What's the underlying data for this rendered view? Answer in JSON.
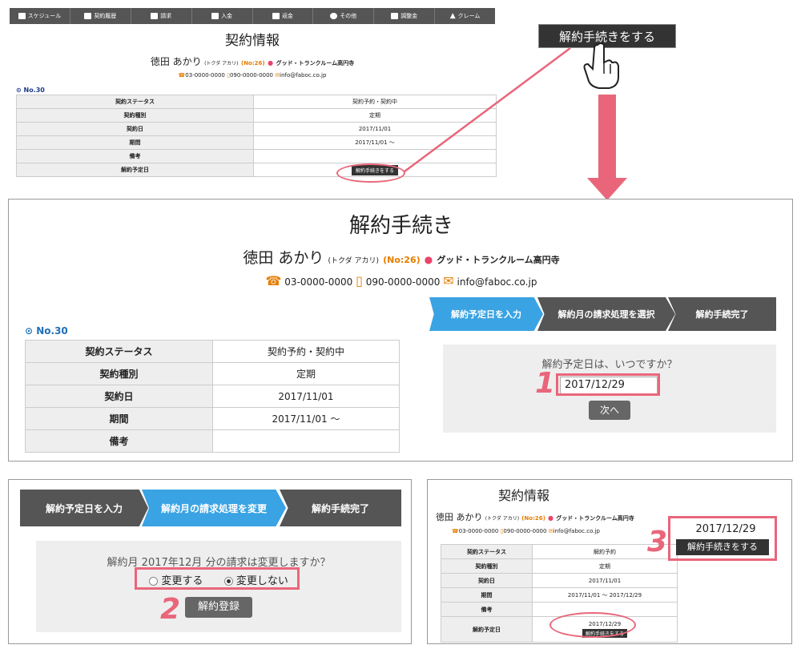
{
  "nav": [
    "スケジュール",
    "契約履歴",
    "請求",
    "入金",
    "返金",
    "その他",
    "調整金",
    "クレーム"
  ],
  "customer": {
    "name": "徳田 あかり",
    "kana": "(トクダ アカリ)",
    "no": "(No:26)",
    "store": "グッド・トランクルーム高円寺",
    "phone": "03-0000-0000",
    "mobile": "090-0000-0000",
    "email": "info@faboc.co.jp"
  },
  "screen1": {
    "title": "契約情報",
    "contract_no": "No.30",
    "rows": [
      {
        "k": "契約ステータス",
        "v": "契約予約・契約中"
      },
      {
        "k": "契約種別",
        "v": "定期"
      },
      {
        "k": "契約日",
        "v": "2017/11/01"
      },
      {
        "k": "期間",
        "v": "2017/11/01 ～"
      },
      {
        "k": "備考",
        "v": ""
      },
      {
        "k": "解約予定日",
        "v": ""
      }
    ],
    "cancel_button": "解約手続きをする"
  },
  "callout_button": "解約手続きをする",
  "screen2": {
    "title": "解約手続き",
    "contract_no": "No.30",
    "rows": [
      {
        "k": "契約ステータス",
        "v": "契約予約・契約中"
      },
      {
        "k": "契約種別",
        "v": "定期"
      },
      {
        "k": "契約日",
        "v": "2017/11/01"
      },
      {
        "k": "期間",
        "v": "2017/11/01 ～"
      },
      {
        "k": "備考",
        "v": ""
      }
    ],
    "steps": [
      "解約予定日を入力",
      "解約月の請求処理を選択",
      "解約手続完了"
    ],
    "question": "解約予定日は、いつですか？",
    "date_value": "2017/12/29",
    "next_button": "次へ",
    "marker": "1"
  },
  "screen3": {
    "steps": [
      "解約予定日を入力",
      "解約月の請求処理を変更",
      "解約手続完了"
    ],
    "question": "解約月 2017年12月 分の請求は変更しますか？",
    "option_change": "変更する",
    "option_keep": "変更しない",
    "submit_button": "解約登録",
    "marker": "2"
  },
  "screen4": {
    "title": "契約情報",
    "rows": [
      {
        "k": "契約ステータス",
        "v": "解約予約"
      },
      {
        "k": "契約種別",
        "v": "定期"
      },
      {
        "k": "契約日",
        "v": "2017/11/01"
      },
      {
        "k": "期間",
        "v": "2017/11/01 ～ 2017/12/29"
      },
      {
        "k": "備考",
        "v": ""
      }
    ],
    "cancel_label": "解約予定日",
    "cancel_date": "2017/12/29",
    "cancel_button": "解約手続きをする",
    "callout_date": "2017/12/29",
    "callout_button": "解約手続きをする",
    "marker": "3"
  }
}
